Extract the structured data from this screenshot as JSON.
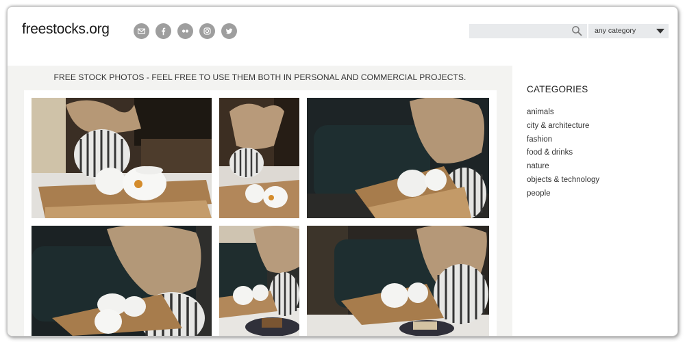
{
  "header": {
    "logo": "freestocks.org",
    "social_icons": [
      "mail-icon",
      "facebook-icon",
      "flickr-icon",
      "instagram-icon",
      "twitter-icon"
    ],
    "search": {
      "value": "",
      "placeholder": ""
    },
    "category_select": {
      "selected": "any category"
    }
  },
  "main": {
    "tagline": "FREE STOCK PHOTOS - FEEL FREE TO USE THEM BOTH IN PERSONAL AND COMMERCIAL PROJECTS.",
    "photos_count_visible": 6
  },
  "sidebar": {
    "title": "CATEGORIES",
    "items": [
      "animals",
      "city & architecture",
      "fashion",
      "food & drinks",
      "nature",
      "objects & technology",
      "people"
    ]
  },
  "colors": {
    "icon_gray": "#9e9e9e",
    "input_bg": "#e8eaec",
    "main_bg": "#f3f3f1"
  }
}
